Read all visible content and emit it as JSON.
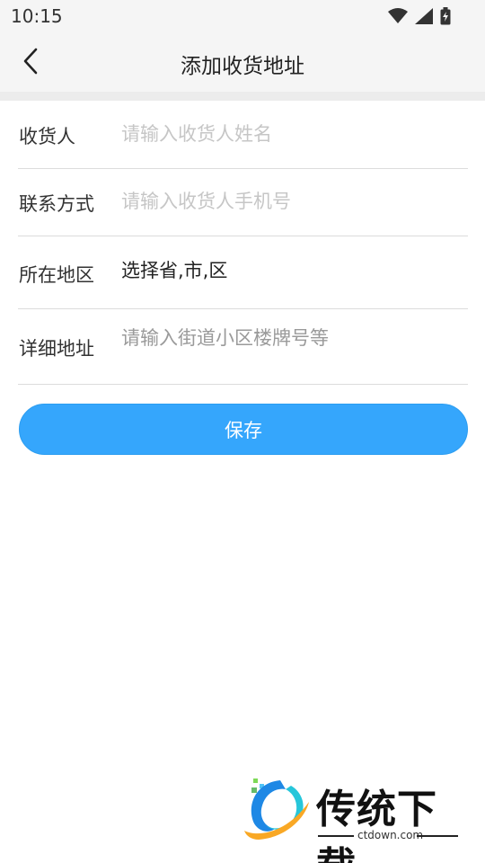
{
  "status_bar": {
    "time": "10:15",
    "icons": [
      "wifi-icon",
      "cell-signal-icon",
      "battery-icon"
    ]
  },
  "app_bar": {
    "back_icon": "chevron-left-icon",
    "title": "添加收货地址"
  },
  "form": {
    "recipient": {
      "label": "收货人",
      "placeholder": "请输入收货人姓名",
      "value": ""
    },
    "phone": {
      "label": "联系方式",
      "placeholder": "请输入收货人手机号",
      "value": ""
    },
    "region": {
      "label": "所在地区",
      "value": "选择省,市,区"
    },
    "address": {
      "label": "详细地址",
      "placeholder": "请输入街道小区楼牌号等",
      "value": ""
    }
  },
  "actions": {
    "save_label": "保存"
  },
  "watermark": {
    "brand": "传统下载",
    "domain": "ctdown.com"
  },
  "colors": {
    "accent": "#35a6fc",
    "placeholder": "#c6c6c6",
    "divider": "#dcdcdc",
    "header_bg": "#f5f5f5"
  }
}
